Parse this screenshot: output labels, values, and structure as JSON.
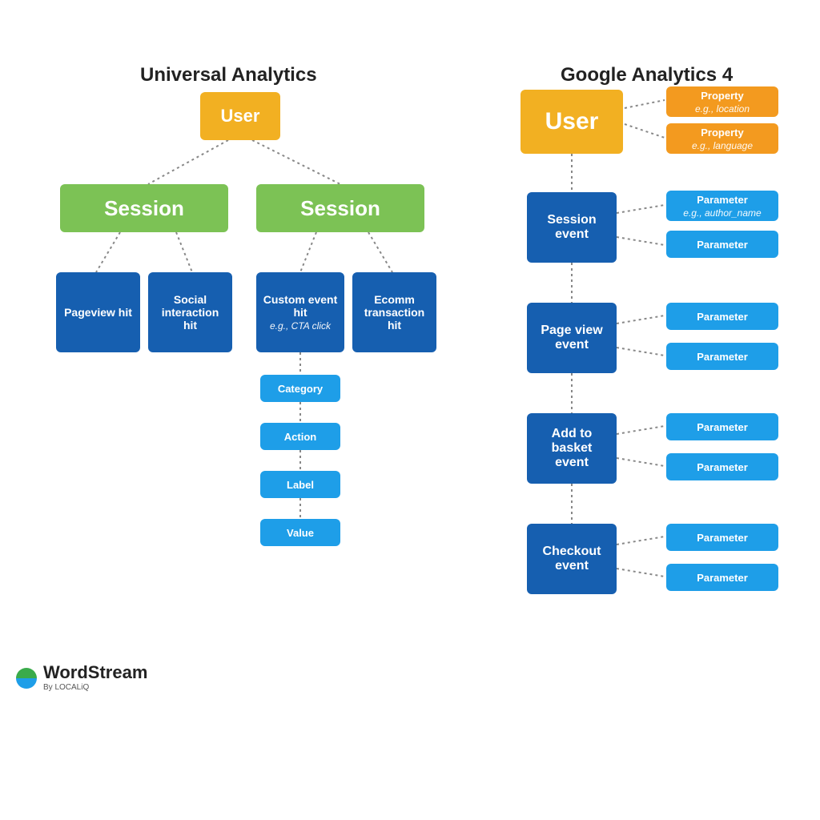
{
  "ua": {
    "title": "Universal Analytics",
    "user": "User",
    "sessions": [
      "Session",
      "Session"
    ],
    "hits_left": [
      {
        "label": "Pageview hit"
      },
      {
        "label": "Social interaction hit"
      }
    ],
    "hits_right": [
      {
        "label": "Custom event hit",
        "sub": "e.g., CTA click"
      },
      {
        "label": "Ecomm transaction hit"
      }
    ],
    "event_params": [
      "Category",
      "Action",
      "Label",
      "Value"
    ]
  },
  "ga4": {
    "title": "Google Analytics 4",
    "user": "User",
    "user_properties": [
      {
        "label": "Property",
        "sub": "e.g., location"
      },
      {
        "label": "Property",
        "sub": "e.g., language"
      }
    ],
    "events": [
      {
        "label": "Session event",
        "params": [
          {
            "label": "Parameter",
            "sub": "e.g., author_name"
          },
          {
            "label": "Parameter"
          }
        ]
      },
      {
        "label": "Page view event",
        "params": [
          {
            "label": "Parameter"
          },
          {
            "label": "Parameter"
          }
        ]
      },
      {
        "label": "Add to basket event",
        "params": [
          {
            "label": "Parameter"
          },
          {
            "label": "Parameter"
          }
        ]
      },
      {
        "label": "Checkout event",
        "params": [
          {
            "label": "Parameter"
          },
          {
            "label": "Parameter"
          }
        ]
      }
    ]
  },
  "brand": {
    "name": "WordStream",
    "byline": "By LOCALiQ"
  },
  "colors": {
    "yellow": "#f2b022",
    "orange": "#f39a1f",
    "green": "#7cc255",
    "darkblue": "#165fb0",
    "lightblue": "#1e9ee8"
  }
}
